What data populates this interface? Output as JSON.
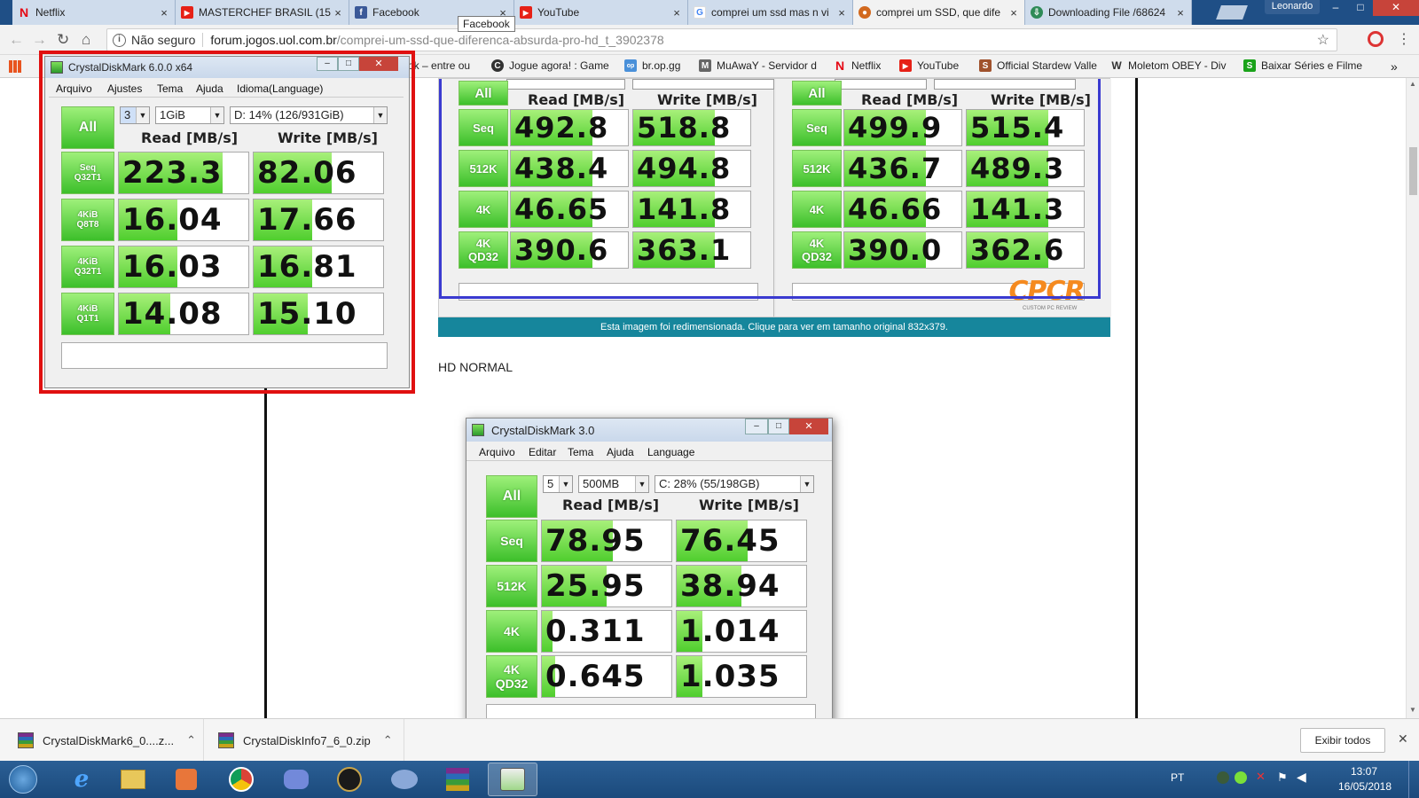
{
  "tabs": [
    {
      "title": "Netflix",
      "icon": "N",
      "color": "#e50914"
    },
    {
      "title": "MASTERCHEF BRASIL (15",
      "icon": "▶",
      "color": "#e62117"
    },
    {
      "title": "Facebook",
      "icon": "f",
      "color": "#3b5998"
    },
    {
      "title": "YouTube",
      "icon": "▶",
      "color": "#e62117"
    },
    {
      "title": "comprei um ssd mas n vi",
      "icon": "G",
      "color": "#4285f4"
    },
    {
      "title": "comprei um SSD, que dife",
      "icon": "●",
      "color": "#d2691e"
    },
    {
      "title": "Downloading File /68624",
      "icon": "⇩",
      "color": "#2e8b57"
    }
  ],
  "tooltip": "Facebook",
  "profile": "Leonardo",
  "window_buttons": {
    "minimize": "–",
    "maximize": "□",
    "close": "✕"
  },
  "omnibox": {
    "security": "Não seguro",
    "host": "forum.jogos.uol.com.br",
    "path": "/comprei-um-ssd-que-diferenca-absurda-pro-hd_t_3902378"
  },
  "bookmarks": [
    {
      "label": "ok – entre ou",
      "icon": "",
      "color": "#f2f2f2"
    },
    {
      "label": "Jogue agora! : Game",
      "icon": "C",
      "color": "#333"
    },
    {
      "label": "br.op.gg",
      "icon": "op",
      "color": "#4a90d9"
    },
    {
      "label": "MuAwaY - Servidor d",
      "icon": "M",
      "color": "#555"
    },
    {
      "label": "Netflix",
      "icon": "N",
      "color": "#e50914"
    },
    {
      "label": "YouTube",
      "icon": "▶",
      "color": "#e62117"
    },
    {
      "label": "Official Stardew Valle",
      "icon": "S",
      "color": "#a0522d"
    },
    {
      "label": "Moletom OBEY - Div",
      "icon": "W",
      "color": "#333"
    },
    {
      "label": "Baixar Séries e Filme",
      "icon": "S",
      "color": "#1aa31a"
    }
  ],
  "bookmarks_more": "»",
  "ssd_image": {
    "headers": {
      "read": "Read [MB/s]",
      "write": "Write [MB/s]"
    },
    "all_label": "All",
    "left": {
      "rows": [
        {
          "label": "Seq",
          "read": "492.8",
          "write": "518.8"
        },
        {
          "label": "512K",
          "read": "438.4",
          "write": "494.8"
        },
        {
          "label": "4K",
          "read": "46.65",
          "write": "141.8"
        },
        {
          "label": "4K\nQD32",
          "read": "390.6",
          "write": "363.1"
        }
      ]
    },
    "right": {
      "rows": [
        {
          "label": "Seq",
          "read": "499.9",
          "write": "515.4"
        },
        {
          "label": "512K",
          "read": "436.7",
          "write": "489.3"
        },
        {
          "label": "4K",
          "read": "46.66",
          "write": "141.3"
        },
        {
          "label": "4K\nQD32",
          "read": "390.0",
          "write": "362.6"
        }
      ]
    },
    "watermark": "CPCR",
    "watermark_sub": "CUSTOM PC REVIEW"
  },
  "resize_notice": "Esta imagem foi redimensionada. Clique para ver em tamanho original 832x379.",
  "section_title": "HD NORMAL",
  "cdm3": {
    "title": "CrystalDiskMark 3.0",
    "menu": [
      "Arquivo",
      "Editar",
      "Tema",
      "Ajuda",
      "Language"
    ],
    "count": "5",
    "size": "500MB",
    "drive": "C: 28% (55/198GB)",
    "all_label": "All",
    "read_header": "Read [MB/s]",
    "write_header": "Write [MB/s]",
    "rows": [
      {
        "label1": "Seq",
        "label2": "",
        "read": "78.95",
        "write": "76.45",
        "read_fill": 0.55,
        "write_fill": 0.55
      },
      {
        "label1": "512K",
        "label2": "",
        "read": "25.95",
        "write": "38.94",
        "read_fill": 0.5,
        "write_fill": 0.5
      },
      {
        "label1": "4K",
        "label2": "",
        "read": "0.311",
        "write": "1.014",
        "read_fill": 0.08,
        "write_fill": 0.2
      },
      {
        "label1": "4K",
        "label2": "QD32",
        "read": "0.645",
        "write": "1.035",
        "read_fill": 0.1,
        "write_fill": 0.2
      }
    ]
  },
  "cdm6": {
    "title": "CrystalDiskMark 6.0.0 x64",
    "menu": [
      "Arquivo",
      "Ajustes",
      "Tema",
      "Ajuda",
      "Idioma(Language)"
    ],
    "count": "3",
    "size": "1GiB",
    "drive": "D: 14% (126/931GiB)",
    "all_label": "All",
    "read_header": "Read [MB/s]",
    "write_header": "Write [MB/s]",
    "rows": [
      {
        "label1": "Seq",
        "label2": "Q32T1",
        "read": "223.3",
        "write": "82.06",
        "read_fill": 0.8,
        "write_fill": 0.6
      },
      {
        "label1": "4KiB",
        "label2": "Q8T8",
        "read": "16.04",
        "write": "17.66",
        "read_fill": 0.45,
        "write_fill": 0.45
      },
      {
        "label1": "4KiB",
        "label2": "Q32T1",
        "read": "16.03",
        "write": "16.81",
        "read_fill": 0.45,
        "write_fill": 0.45
      },
      {
        "label1": "4KiB",
        "label2": "Q1T1",
        "read": "14.08",
        "write": "15.10",
        "read_fill": 0.4,
        "write_fill": 0.42
      }
    ]
  },
  "downloads": {
    "items": [
      "CrystalDiskMark6_0....z...",
      "CrystalDiskInfo7_6_0.zip"
    ],
    "show_all": "Exibir todos",
    "close": "✕"
  },
  "taskbar": {
    "lang": "PT",
    "time": "13:07",
    "date": "16/05/2018"
  }
}
